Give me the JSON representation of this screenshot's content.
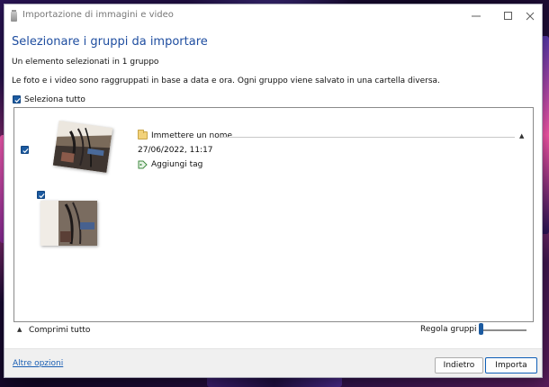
{
  "window": {
    "title": "Importazione di immagini e video",
    "controls": {
      "minimize": "—",
      "maximize": "☐",
      "close": "✕"
    }
  },
  "heading": "Selezionare i gruppi da importare",
  "selection_info": "Un elemento selezionati in 1 gruppo",
  "description": "Le foto e i video sono raggruppati in base a data e ora. Ogni gruppo viene salvato in una cartella diversa.",
  "select_all": {
    "label": "Seleziona tutto",
    "checked": true
  },
  "groups": [
    {
      "checked": true,
      "name_placeholder": "Immettere un nome",
      "date": "27/06/2022, 11:17",
      "add_tag_label": "Aggiungi tag",
      "expanded": true,
      "items": [
        {
          "checked": true
        }
      ]
    }
  ],
  "collapse_all_label": "Comprimi tutto",
  "adjust_groups": {
    "label": "Regola gruppi",
    "value": 0
  },
  "footer": {
    "more_options_link": "Altre opzioni",
    "back_button": "Indietro",
    "import_button": "Importa"
  },
  "colors": {
    "accent": "#1b5aa0",
    "heading": "#1f4ea0",
    "link": "#1a5fb4"
  },
  "icons": [
    "app-icon",
    "folder-icon",
    "tag-icon",
    "checkbox-icon",
    "chevron-up-icon"
  ]
}
